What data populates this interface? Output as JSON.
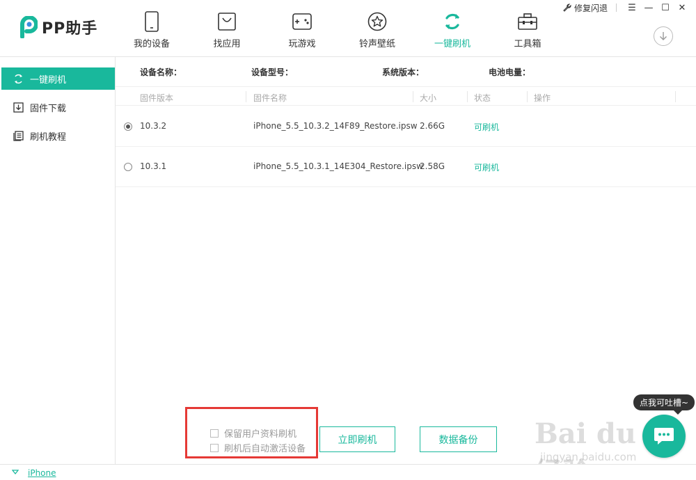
{
  "app": {
    "name": "PP助手",
    "brand_color": "#19b89c"
  },
  "window_controls": {
    "repair_label": "修复闪退",
    "menu_icon": "menu-icon",
    "minimize_icon": "minimize-icon",
    "maximize_icon": "maximize-icon",
    "close_icon": "close-icon"
  },
  "nav": {
    "items": [
      {
        "label": "我的设备",
        "icon": "phone-icon"
      },
      {
        "label": "找应用",
        "icon": "shopping-bag-icon"
      },
      {
        "label": "玩游戏",
        "icon": "gamepad-icon"
      },
      {
        "label": "铃声壁纸",
        "icon": "star-icon"
      },
      {
        "label": "一键刷机",
        "icon": "refresh-icon",
        "active": true
      },
      {
        "label": "工具箱",
        "icon": "toolbox-icon"
      }
    ]
  },
  "sidebar": {
    "items": [
      {
        "label": "一键刷机",
        "icon": "refresh-icon",
        "active": true
      },
      {
        "label": "固件下载",
        "icon": "download-icon"
      },
      {
        "label": "刷机教程",
        "icon": "document-icon"
      }
    ]
  },
  "device_info": {
    "name_label": "设备名称：",
    "model_label": "设备型号：",
    "version_label": "系统版本：",
    "battery_label": "电池电量："
  },
  "firmware_table": {
    "columns": [
      "固件版本",
      "固件名称",
      "大小",
      "状态",
      "操作"
    ],
    "rows": [
      {
        "version": "10.3.2",
        "name": "iPhone_5.5_10.3.2_14F89_Restore.ipsw",
        "size": "2.66G",
        "status": "可刷机",
        "selected": true
      },
      {
        "version": "10.3.1",
        "name": "iPhone_5.5_10.3.1_14E304_Restore.ipsw",
        "size": "2.58G",
        "status": "可刷机",
        "selected": false
      }
    ]
  },
  "options": {
    "keep_data_label": "保留用户资料刷机",
    "auto_activate_label": "刷机后自动激活设备"
  },
  "actions": {
    "flash_now_label": "立即刷机",
    "backup_label": "数据备份"
  },
  "feedback": {
    "tooltip": "点我可吐槽~"
  },
  "status_bar": {
    "device": "iPhone"
  },
  "watermark": {
    "text": "Bai du 经验",
    "url": "jingyan.baidu.com"
  }
}
